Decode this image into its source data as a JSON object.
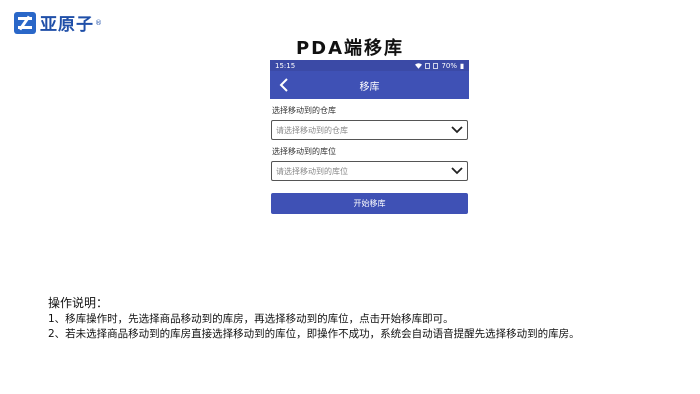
{
  "brand": {
    "name": "亚原子",
    "reg_mark": "®"
  },
  "page_title": "PDA端移库",
  "status_bar": {
    "time": "15:15",
    "battery": "70%"
  },
  "nav": {
    "title": "移库"
  },
  "form": {
    "warehouse_label": "选择移动到的仓库",
    "warehouse_placeholder": "请选择移动到的仓库",
    "location_label": "选择移动到的库位",
    "location_placeholder": "请选择移动到的库位",
    "start_button": "开始移库"
  },
  "instructions": {
    "heading": "操作说明：",
    "items": [
      "1、移库操作时，先选择商品移动到的库房，再选择移动到的库位，点击开始移库即可。",
      "2、若未选择商品移动到的库房直接选择移动到的库位，即操作不成功，系统会自动语音提醒先选择移动到的库房。"
    ]
  }
}
